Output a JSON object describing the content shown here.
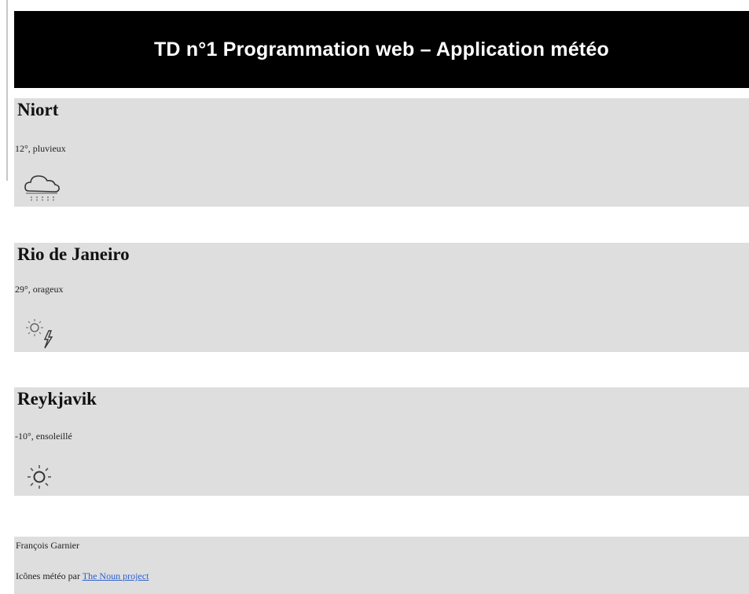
{
  "header": {
    "title": "TD n°1 Programmation web – Application météo"
  },
  "cities": [
    {
      "name": "Niort",
      "description": "12°, pluvieux",
      "icon": "rain-cloud-icon"
    },
    {
      "name": "Rio de Janeiro",
      "description": "29°, orageux",
      "icon": "sun-storm-icon"
    },
    {
      "name": "Reykjavik",
      "description": "-10°, ensoleillé",
      "icon": "sun-icon"
    }
  ],
  "footer": {
    "author": "François Garnier",
    "credits_prefix": "Icônes météo par",
    "credits_link": "The Noun project"
  },
  "colors": {
    "header_bg": "#000000",
    "header_text": "#ffffff",
    "section_bg": "#dedede",
    "link": "#2a5fd0"
  }
}
